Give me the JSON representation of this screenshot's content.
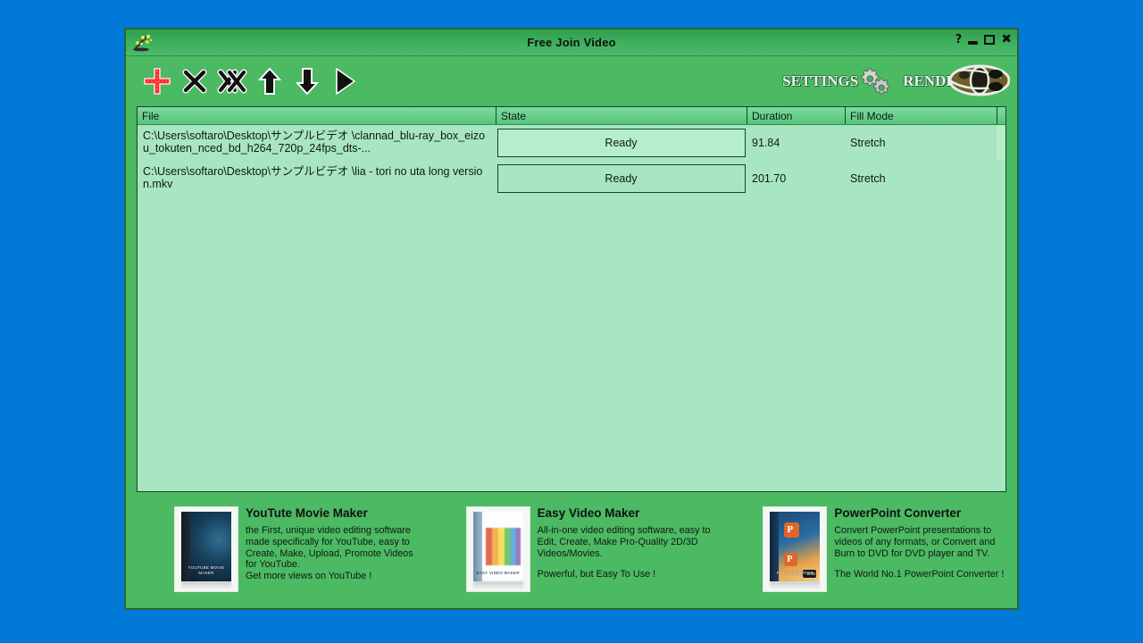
{
  "window": {
    "title": "Free Join Video",
    "icon": "magic-wand-sparkle-icon",
    "controls": {
      "help": "?",
      "minimize": "minimize",
      "maximize": "maximize",
      "close": "X"
    }
  },
  "toolbar": {
    "buttons": [
      {
        "name": "add-file-button",
        "icon": "plus-icon",
        "label": "+"
      },
      {
        "name": "remove-file-button",
        "icon": "cross-x-icon",
        "label": "X"
      },
      {
        "name": "clear-all-button",
        "icon": "double-cross-icon",
        "label": "XX"
      },
      {
        "name": "move-up-button",
        "icon": "arrow-up-icon",
        "label": "Up"
      },
      {
        "name": "move-down-button",
        "icon": "arrow-down-icon",
        "label": "Down"
      },
      {
        "name": "play-button",
        "icon": "play-triangle-icon",
        "label": "Play"
      }
    ],
    "settings_label": "SETTINGS",
    "render_label": "RENDER"
  },
  "list": {
    "columns": [
      "File",
      "State",
      "Duration",
      "Fill Mode",
      ""
    ],
    "rows": [
      {
        "file": "C:\\Users\\softaro\\Desktop\\サンプルビデオ \\clannad_blu-ray_box_eizou_tokuten_nced_bd_h264_720p_24fps_dts-...",
        "state": "Ready",
        "duration": "91.84",
        "fill_mode": "Stretch",
        "selected": true
      },
      {
        "file": "C:\\Users\\softaro\\Desktop\\サンプルビデオ \\lia - tori no uta long version.mkv",
        "state": "Ready",
        "duration": "201.70",
        "fill_mode": "Stretch",
        "selected": false
      }
    ]
  },
  "promos": [
    {
      "title": "YouTute Movie Maker",
      "boxshot_label": "YOUTUBE MOVIE MAKER",
      "desc": "the First, unique video editing software made specifically for YouTube, easy to Create, Make, Upload, Promote Videos for YouTube.",
      "tagline": "Get more views on YouTube !",
      "tagline_gap": false
    },
    {
      "title": "Easy Video Maker",
      "boxshot_label": "EASY VIDEO MAKER",
      "desc": "All-in-one video editing software, easy to Edit, Create, Make Pro-Quality 2D/3D Videos/Movies.",
      "tagline": "Powerful, but Easy To Use !",
      "tagline_gap": true
    },
    {
      "title": "PowerPoint Converter",
      "boxshot_label": "PPT CONVERTER",
      "desc": "Convert PowerPoint presentations to videos of any formats, or Convert and Burn to DVD for DVD player and TV.",
      "tagline": "The World No.1 PowerPoint Converter !",
      "tagline_gap": true
    }
  ],
  "colors": {
    "desktop": "#0079d7",
    "window_bg": "#4cb963",
    "titlebar_top": "#2f9d4e",
    "titlebar_bottom": "#4dbc6a",
    "list_bg": "#a8e6c1",
    "row_selected": "#b5efc9",
    "header_top": "#7ddb9d",
    "border": "#17452a",
    "add_icon": "#ff2020"
  }
}
